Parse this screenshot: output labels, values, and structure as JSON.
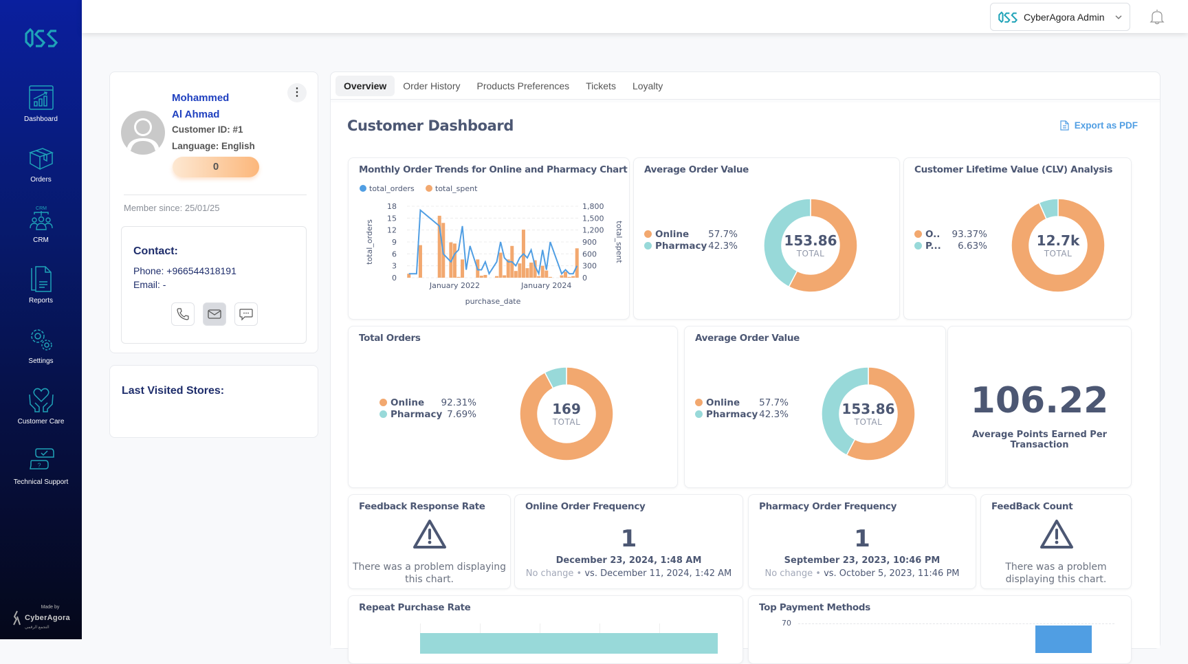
{
  "sidebar": {
    "logo": "OSS",
    "items": [
      {
        "label": "Dashboard",
        "icon": "dashboard-chart-icon"
      },
      {
        "label": "Orders",
        "icon": "box-icon"
      },
      {
        "label": "CRM",
        "icon": "crm-people-icon",
        "icon_caption": "CRM"
      },
      {
        "label": "Reports",
        "icon": "document-icon"
      },
      {
        "label": "Settings",
        "icon": "gears-icon"
      },
      {
        "label": "Customer Care",
        "icon": "heart-hands-icon"
      },
      {
        "label": "Technical Support",
        "icon": "support-chat-icon"
      }
    ],
    "made_by": "Made by",
    "brand": "CyberAgora",
    "brand_arabic": "التجمع الرقمي"
  },
  "topbar": {
    "account_name": "CyberAgora Admin"
  },
  "profile": {
    "first_name": "Mohammed",
    "last_name": "Al Ahmad",
    "customer_id": "Customer ID: #1",
    "language": "Language: English",
    "points": "0",
    "member_since": "Member since: 25/01/25",
    "contact_title": "Contact:",
    "phone": "Phone: +966544318191",
    "email": "Email: -"
  },
  "stores": {
    "title": "Last Visited Stores:"
  },
  "tabs": [
    {
      "label": "Overview",
      "active": true
    },
    {
      "label": "Order History"
    },
    {
      "label": "Products Preferences"
    },
    {
      "label": "Tickets"
    },
    {
      "label": "Loyalty"
    }
  ],
  "dashboard": {
    "title": "Customer Dashboard",
    "export_label": "Export as PDF",
    "colors": {
      "online": "#f2a86f",
      "pharmacy": "#98d9d9",
      "line": "#509ee3",
      "text": "#4c5773"
    },
    "avg_order_value": {
      "title": "Average Order Value",
      "total": "153.86",
      "total_label": "TOTAL",
      "slices": [
        {
          "name": "Online",
          "pct": 57.7,
          "pct_label": "57.7%"
        },
        {
          "name": "Pharmacy",
          "pct": 42.3,
          "pct_label": "42.3%"
        }
      ]
    },
    "clv": {
      "title": "Customer Lifetime Value (CLV) Analysis",
      "total": "12.7k",
      "total_label": "TOTAL",
      "slices": [
        {
          "name": "O..",
          "pct": 93.37,
          "pct_label": "93.37%"
        },
        {
          "name": "P...",
          "pct": 6.63,
          "pct_label": "6.63%"
        }
      ]
    },
    "total_orders": {
      "title": "Total Orders",
      "total": "169",
      "total_label": "TOTAL",
      "slices": [
        {
          "name": "Online",
          "pct": 92.31,
          "pct_label": "92.31%"
        },
        {
          "name": "Pharmacy",
          "pct": 7.69,
          "pct_label": "7.69%"
        }
      ]
    },
    "avg_order_value_2": {
      "title": "Average Order Value",
      "total": "153.86",
      "total_label": "TOTAL",
      "slices": [
        {
          "name": "Online",
          "pct": 57.7,
          "pct_label": "57.7%"
        },
        {
          "name": "Pharmacy",
          "pct": 42.3,
          "pct_label": "42.3%"
        }
      ]
    },
    "avg_points": {
      "value": "106.22",
      "label": "Average Points Earned Per Transaction"
    },
    "feedback_rate": {
      "title": "Feedback Response Rate",
      "error": "There was a problem displaying this chart."
    },
    "online_freq": {
      "title": "Online Order Frequency",
      "value": "1",
      "date": "December 23, 2024, 1:48 AM",
      "change": "No change",
      "compare": "vs. December 11, 2024, 1:42 AM"
    },
    "pharmacy_freq": {
      "title": "Pharmacy Order Frequency",
      "value": "1",
      "date": "September 23, 2023, 10:46 PM",
      "change": "No change",
      "compare": "vs. October 5, 2023, 11:46 PM"
    },
    "feedback_count": {
      "title": "FeedBack Count",
      "error": "There was a problem displaying this chart."
    },
    "repeat_rate": {
      "title": "Repeat Purchase Rate"
    },
    "payment_methods": {
      "title": "Top Payment Methods",
      "y_tick": "70"
    }
  },
  "chart_data": {
    "type": "bar+line",
    "title": "Monthly Order Trends for Online and Pharmacy Chart",
    "xlabel": "purchase_date",
    "ylabel_left": "total_orders",
    "ylabel_right": "total_spent",
    "ylim_left": [
      0,
      18
    ],
    "ylim_right": [
      0,
      1800
    ],
    "yticks_left": [
      "0",
      "3",
      "6",
      "9",
      "12",
      "15",
      "18"
    ],
    "yticks_right": [
      "0",
      "300",
      "600",
      "900",
      "1,200",
      "1,500",
      "1,800"
    ],
    "xticks": [
      "January 2022",
      "January 2024"
    ],
    "legend": [
      "total_orders",
      "total_spent"
    ],
    "grid": true,
    "x_index": [
      0,
      1,
      2,
      3,
      4,
      5,
      6,
      7,
      8,
      9,
      10,
      11,
      12,
      13,
      14,
      15,
      16,
      17,
      18,
      19,
      20,
      21,
      22,
      23,
      24,
      25,
      26,
      27,
      28,
      29,
      30,
      31,
      32,
      33,
      34,
      35,
      36,
      37,
      38,
      39,
      40,
      41,
      42,
      43,
      44
    ],
    "total_spent": [
      100,
      0,
      0,
      820,
      0,
      0,
      0,
      0,
      1560,
      1380,
      0,
      890,
      860,
      20,
      460,
      0,
      0,
      0,
      460,
      50,
      70,
      0,
      0,
      40,
      630,
      60,
      460,
      800,
      170,
      360,
      1210,
      240,
      380,
      440,
      40,
      300,
      180,
      20,
      0,
      0,
      60,
      150,
      20,
      40,
      740
    ],
    "total_orders": [
      1,
      1,
      1,
      17,
      null,
      null,
      null,
      null,
      13,
      6,
      null,
      4,
      6,
      7,
      13,
      2,
      8,
      null,
      2,
      2,
      4,
      1,
      null,
      4,
      9,
      5,
      4,
      4,
      3,
      5,
      6,
      5,
      7,
      3,
      1,
      7,
      2,
      9,
      null,
      null,
      1,
      2,
      1,
      1,
      3
    ]
  }
}
